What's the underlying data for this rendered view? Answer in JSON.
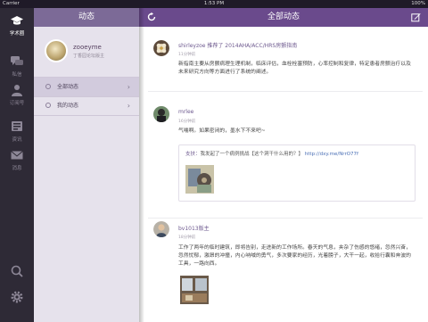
{
  "status_bar": {
    "carrier": "Carrier",
    "time": "1:53 PM",
    "battery": "100%"
  },
  "rail": {
    "items": [
      {
        "label": "学术圈",
        "icon": "graduation-cap-icon"
      },
      {
        "label": "私信",
        "icon": "chat-bubbles-icon"
      },
      {
        "label": "订阅号",
        "icon": "person-icon"
      },
      {
        "label": "资讯",
        "icon": "news-icon"
      },
      {
        "label": "消息",
        "icon": "envelope-icon"
      }
    ],
    "bottom_icons": [
      "search-icon",
      "gear-icon"
    ]
  },
  "menu": {
    "title": "动态",
    "profile": {
      "name": "zooeyme",
      "subtitle": "丁香园论坛版主"
    },
    "items": [
      {
        "label": "全部动态",
        "selected": true
      },
      {
        "label": "我的动态",
        "selected": false
      }
    ]
  },
  "feed": {
    "title": "全部动态",
    "posts": [
      {
        "author": "shirleyzoe",
        "action": " 推荐了 2014AHA/ACC/HRS房颤指南",
        "time": "11分钟前",
        "text": "新指南主要从房颤病理生理机制，临床评估，血栓栓塞预防，心率控制和复律，特定患者房颤治疗以及未来研究方向等方面进行了系统的阐述。"
      },
      {
        "author": "mrlee",
        "action": "",
        "time": "16分钟前",
        "text": "气喘啊。如果密闭的，墨水下不来吧~",
        "quote": {
          "author": "支扶：",
          "body": "我发起了一个病例挑战【这个洞干什么用的？】",
          "link": "http://dxy.me/NrrO77f"
        }
      },
      {
        "author": "bv1013版主",
        "action": "",
        "time": "18分钟前",
        "text": "工作了两年的临时建筑，即将告别，走进新的工作场所。春天的气息，夹杂了伤感的悠绪，忽然兴奋，忽然忧郁，激昂的冲撞，内心呐喊的勇气，多次要家的经历，光着膀子，大干一起，收拾行囊和奔波的工具，一路向西。"
      }
    ]
  },
  "colors": {
    "menu_header": "#7c6a97",
    "feed_header": "#6a4a8c",
    "rail": "#2e2a36",
    "name_link": "#6e5a8f"
  }
}
